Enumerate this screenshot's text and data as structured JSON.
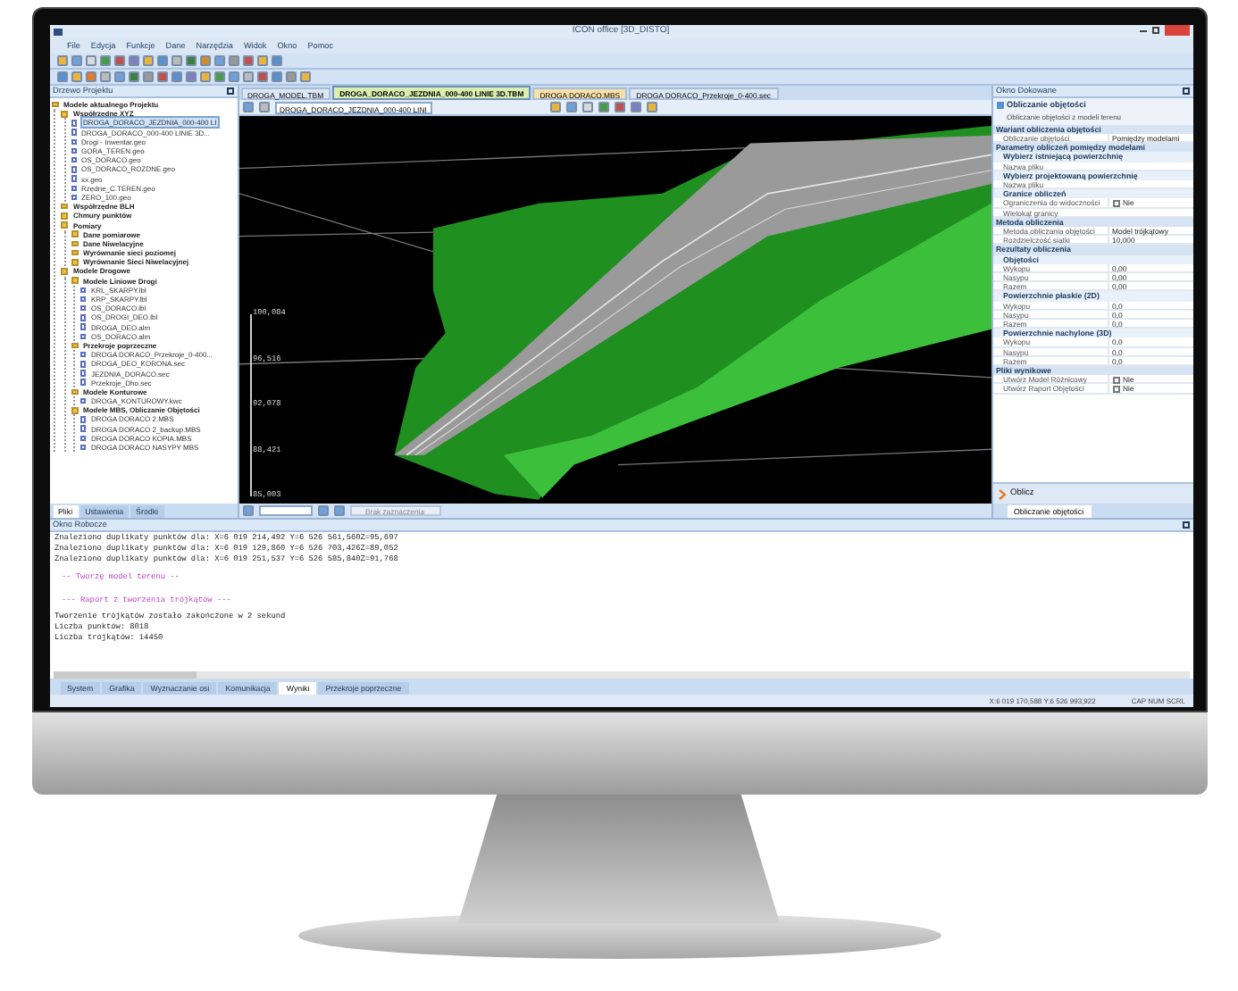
{
  "window": {
    "title": "ICON office [3D_DISTO]"
  },
  "menu": [
    "File",
    "Edycja",
    "Funkcje",
    "Dane",
    "Narzędzia",
    "Widok",
    "Okno",
    "Pomoc"
  ],
  "project_tree": {
    "title": "Drzewo Projektu",
    "items": [
      {
        "label": "Modele aktualnego Projektu",
        "kind": "folder",
        "selected": false,
        "children": [
          {
            "label": "Współrzędne XYZ",
            "kind": "folder",
            "selected": false,
            "children": [
              {
                "label": "DROGA_DORACO_JEZDNIA_000-400 LI",
                "kind": "file",
                "selected": true
              },
              {
                "label": "DROGA_DORACO_000-400 LINIE 3D...",
                "kind": "file",
                "selected": false
              },
              {
                "label": "Drogi - Inwentar.geo",
                "kind": "file",
                "selected": false
              },
              {
                "label": "GORA_TEREN.geo",
                "kind": "file",
                "selected": false
              },
              {
                "label": "OS_DORACO.geo",
                "kind": "file",
                "selected": false
              },
              {
                "label": "OS_DORACO_ROZDNE.geo",
                "kind": "file",
                "selected": false
              },
              {
                "label": "xx.geo",
                "kind": "file",
                "selected": false
              },
              {
                "label": "Rzędne_C.TEREN.geo",
                "kind": "file",
                "selected": false
              },
              {
                "label": "ZERO_100.geo",
                "kind": "file",
                "selected": false
              }
            ]
          },
          {
            "label": "Współrzędne BLH",
            "kind": "folder",
            "selected": false
          },
          {
            "label": "Chmury punktów",
            "kind": "folder",
            "selected": false
          },
          {
            "label": "Pomiary",
            "kind": "folder",
            "selected": false,
            "children": [
              {
                "label": "Dane pomiarowe",
                "kind": "folder",
                "selected": false
              },
              {
                "label": "Dane Niwelacyjne",
                "kind": "folder",
                "selected": false
              },
              {
                "label": "Wyrównanie sieci poziomej",
                "kind": "folder",
                "selected": false
              },
              {
                "label": "Wyrównanie Sieci Niwelacyjnej",
                "kind": "folder",
                "selected": false
              }
            ]
          },
          {
            "label": "Modele Drogowe",
            "kind": "folder",
            "selected": false,
            "children": [
              {
                "label": "Modele Liniowe Drogi",
                "kind": "folder",
                "selected": false,
                "children": [
                  {
                    "label": "KRL_SKARPY.lbl",
                    "kind": "file",
                    "selected": false
                  },
                  {
                    "label": "KRP_SKARPY.lbl",
                    "kind": "file",
                    "selected": false
                  },
                  {
                    "label": "OS_DORACO.lbl",
                    "kind": "file",
                    "selected": false
                  },
                  {
                    "label": "OS_DROGI_DEO.lbl",
                    "kind": "file",
                    "selected": false
                  },
                  {
                    "label": "DROGA_DEO.alm",
                    "kind": "file",
                    "selected": false
                  },
                  {
                    "label": "OS_DORACO.alm",
                    "kind": "file",
                    "selected": false
                  }
                ]
              },
              {
                "label": "Przekroje poprzeczne",
                "kind": "folder",
                "selected": false,
                "children": [
                  {
                    "label": "DROGA DORACO_Przekroje_0-400...",
                    "kind": "file",
                    "selected": false
                  },
                  {
                    "label": "DROGA_DEO_KORONA.sec",
                    "kind": "file",
                    "selected": false
                  },
                  {
                    "label": "JEZDNIA_DORACO.sec",
                    "kind": "file",
                    "selected": false
                  },
                  {
                    "label": "Przekroje_Dho.sec",
                    "kind": "file",
                    "selected": false
                  }
                ]
              },
              {
                "label": "Modele Konturowe",
                "kind": "folder",
                "selected": false,
                "children": [
                  {
                    "label": "DROGA_KONTUROWY.kwc",
                    "kind": "file",
                    "selected": false
                  }
                ]
              },
              {
                "label": "Modele MBS, Obliczanie Objętości",
                "kind": "folder",
                "selected": false,
                "children": [
                  {
                    "label": "DROGA DORACO 2.MBS",
                    "kind": "file",
                    "selected": false
                  },
                  {
                    "label": "DROGA DORACO 2_backup.MBS",
                    "kind": "file",
                    "selected": false
                  },
                  {
                    "label": "DROGA DORACO KOPIA.MBS",
                    "kind": "file",
                    "selected": false
                  },
                  {
                    "label": "DROGA DORACO NASYPY MBS",
                    "kind": "file",
                    "selected": false
                  }
                ]
              }
            ]
          }
        ]
      }
    ],
    "tabs": [
      {
        "label": "Pliki",
        "selected": true
      },
      {
        "label": "Ustawienia",
        "selected": false
      },
      {
        "label": "Środki",
        "selected": false
      }
    ]
  },
  "document_tabs": [
    {
      "label": "DROGA_MODEL.TBM",
      "selected": false,
      "color": "#dbe7f5"
    },
    {
      "label": "DROGA_DORACO_JEZDNIA_000-400 LINIE 3D.TBM",
      "selected": true,
      "color": "#d8efb0"
    },
    {
      "label": "DROGA DORACO.MBS",
      "selected": false,
      "color": "#f7dfa8"
    },
    {
      "label": "DROGA DORACO_Przekroje_0-400.sec",
      "selected": false,
      "color": "#dbe7f5"
    }
  ],
  "viewer": {
    "model_select": "DROGA_DORACO_JEZDNIA_000-400 LINI",
    "scale_labels": [
      "100,084",
      "96,516",
      "92,078",
      "88,421",
      "85,003"
    ],
    "status_text": "Brak zaznaczenia"
  },
  "docking_panel": {
    "title": "Okno Dokowane",
    "tool_title": "Obliczanie objętości",
    "tool_subtitle": "Obliczanie objętości z modeli terenu",
    "properties": [
      {
        "kind": "section",
        "label": "Wariant obliczenia objętości"
      },
      {
        "kind": "row",
        "label": "Obliczanie objętości",
        "value": "Pomiędzy modelami"
      },
      {
        "kind": "section",
        "label": "Parametry obliczeń pomiędzy modelami"
      },
      {
        "kind": "group",
        "label": "Wybierz istniejącą powierzchnię"
      },
      {
        "kind": "row",
        "label": "Nazwa pliku"
      },
      {
        "kind": "group",
        "label": "Wybierz projektowaną powierzchnię"
      },
      {
        "kind": "row",
        "label": "Nazwa pliku"
      },
      {
        "kind": "group",
        "label": "Granice obliczeń"
      },
      {
        "kind": "check",
        "label": "Ograniczenia do widoczności",
        "value": "Nie",
        "checked": false
      },
      {
        "kind": "row",
        "label": "Wielokąt granicy"
      },
      {
        "kind": "section",
        "label": "Metoda obliczenia"
      },
      {
        "kind": "row",
        "label": "Metoda obliczania objętości",
        "value": "Model trójkątowy"
      },
      {
        "kind": "row",
        "label": "Rozdzielczość siatki",
        "value": "10,000"
      },
      {
        "kind": "section",
        "label": "Rezultaty obliczenia"
      },
      {
        "kind": "group",
        "label": "Objętości"
      },
      {
        "kind": "row",
        "label": "Wykopu",
        "value": "0,00"
      },
      {
        "kind": "row",
        "label": "Nasypu",
        "value": "0,00"
      },
      {
        "kind": "row",
        "label": "Razem",
        "value": "0,00"
      },
      {
        "kind": "group",
        "label": "Powierzchnie płaskie (2D)"
      },
      {
        "kind": "row",
        "label": "Wykopu",
        "value": "0,0"
      },
      {
        "kind": "row",
        "label": "Nasypu",
        "value": "0,0"
      },
      {
        "kind": "row",
        "label": "Razem",
        "value": "0,0"
      },
      {
        "kind": "group",
        "label": "Powierzchnie nachylone (3D)"
      },
      {
        "kind": "row",
        "label": "Wykopu",
        "value": "0,0"
      },
      {
        "kind": "row",
        "label": "Nasypu",
        "value": "0,0"
      },
      {
        "kind": "row",
        "label": "Razem",
        "value": "0,0"
      },
      {
        "kind": "section",
        "label": "Pliki wynikowe"
      },
      {
        "kind": "check",
        "label": "Utwórz Model Różnicowy",
        "value": "Nie",
        "checked": false
      },
      {
        "kind": "check",
        "label": "Utwórz Raport Objętości",
        "value": "Nie",
        "checked": false
      }
    ],
    "action_button": "Oblicz",
    "tabs": [
      {
        "label": "Obliczanie objętości",
        "selected": true
      }
    ]
  },
  "output_panel": {
    "title": "Okno Robocze",
    "lines": [
      {
        "kind": "info",
        "text": "Znaleziono duplikaty punktów dla: X=6 019 214,492 Y=6 526 561,560Z=95,697"
      },
      {
        "kind": "info",
        "text": "Znaleziono duplikaty punktów dla: X=6 019 129,860 Y=6 526 703,426Z=89,052"
      },
      {
        "kind": "info",
        "text": "Znaleziono duplikaty punktów dla: X=6 019 251,537 Y=6 526 585,840Z=91,768"
      },
      {
        "kind": "heading",
        "text": "-- Tworzę model terenu --"
      },
      {
        "kind": "heading",
        "text": "--- Raport z tworzenia trójkątów ---"
      },
      {
        "kind": "info",
        "text": "Tworzenie trójkątów zostało zakończone w 2 sekund"
      },
      {
        "kind": "info",
        "text": "Liczba punktów: 8018"
      },
      {
        "kind": "info",
        "text": "Liczba trójkątów: 14450"
      }
    ],
    "tabs": [
      {
        "label": "System",
        "selected": false
      },
      {
        "label": "Grafika",
        "selected": false
      },
      {
        "label": "Wyznaczanie osi",
        "selected": false
      },
      {
        "label": "Komunikacja",
        "selected": false
      },
      {
        "label": "Wyniki",
        "selected": true
      },
      {
        "label": "Przekroje poprzeczne",
        "selected": false
      }
    ]
  },
  "status_bar": {
    "coordinates": "X:6 019 170,588 Y:6 526 993,922",
    "indicators": "CAP NUM SCRL"
  }
}
